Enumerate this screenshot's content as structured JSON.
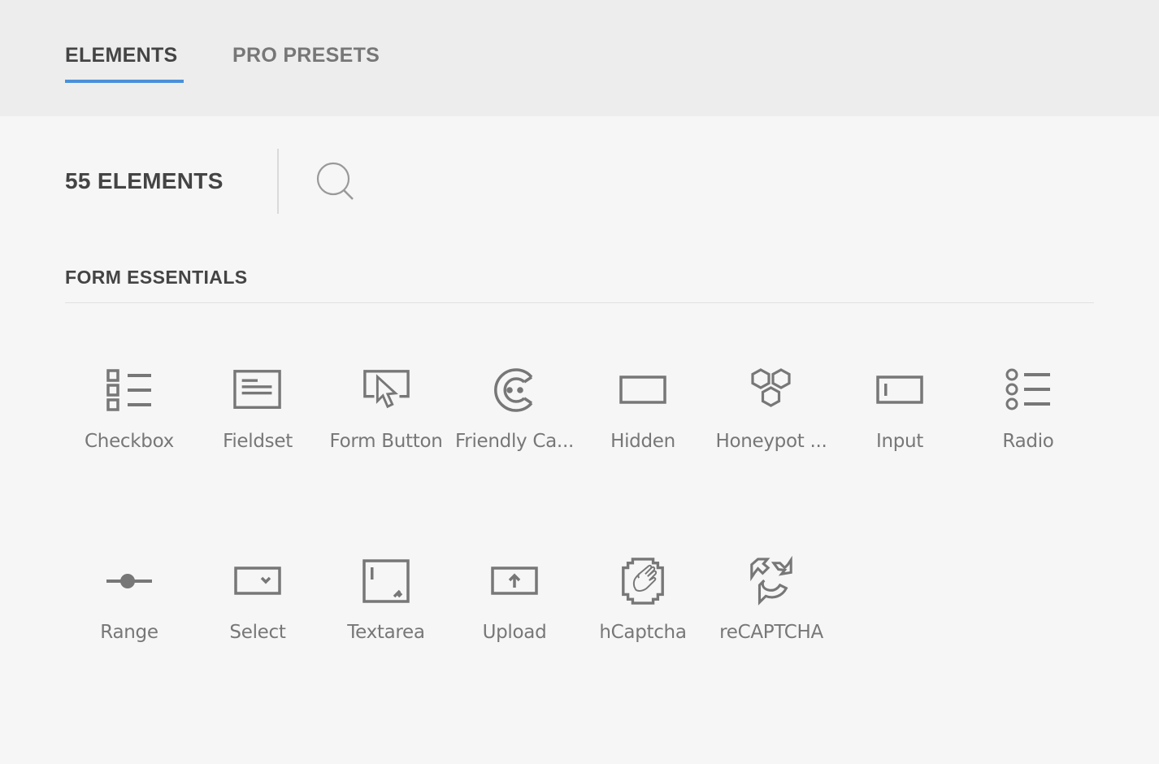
{
  "tabs": [
    {
      "label": "ELEMENTS",
      "active": true
    },
    {
      "label": "PRO PRESETS",
      "active": false
    }
  ],
  "accent_color": "#4a90d9",
  "toolbar": {
    "count_label": "55 ELEMENTS",
    "search_icon": "search-icon"
  },
  "section": {
    "title": "FORM ESSENTIALS",
    "items": [
      {
        "label": "Checkbox",
        "icon": "checkbox-list-icon"
      },
      {
        "label": "Fieldset",
        "icon": "fieldset-icon"
      },
      {
        "label": "Form Button",
        "icon": "cursor-button-icon"
      },
      {
        "label": "Friendly Ca...",
        "icon": "friendly-captcha-icon"
      },
      {
        "label": "Hidden",
        "icon": "hidden-field-icon"
      },
      {
        "label": "Honeypot ...",
        "icon": "honeypot-icon"
      },
      {
        "label": "Input",
        "icon": "input-field-icon"
      },
      {
        "label": "Radio",
        "icon": "radio-list-icon"
      },
      {
        "label": "Range",
        "icon": "range-slider-icon"
      },
      {
        "label": "Select",
        "icon": "select-dropdown-icon"
      },
      {
        "label": "Textarea",
        "icon": "textarea-icon"
      },
      {
        "label": "Upload",
        "icon": "upload-icon"
      },
      {
        "label": "hCaptcha",
        "icon": "hcaptcha-icon"
      },
      {
        "label": "reCAPTCHA",
        "icon": "recaptcha-icon"
      }
    ]
  }
}
